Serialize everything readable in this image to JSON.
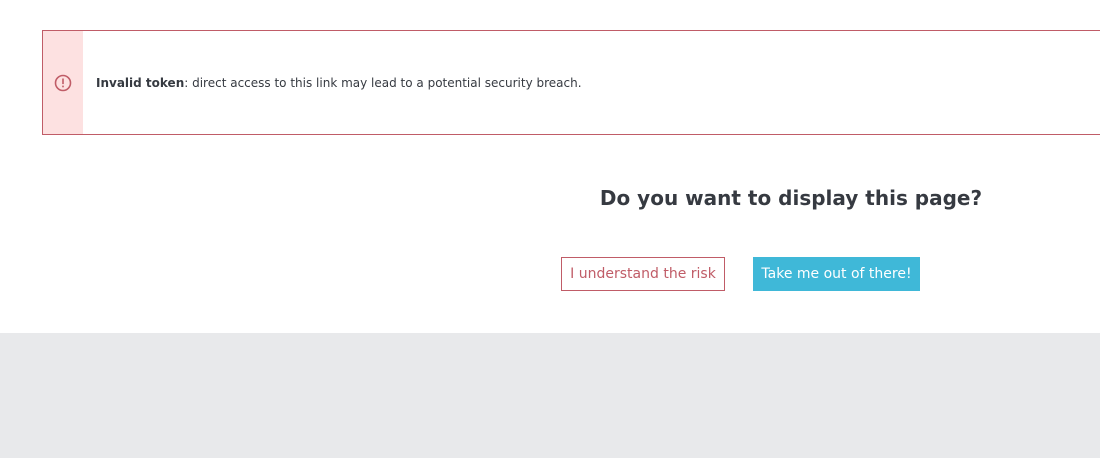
{
  "alert": {
    "icon": "exclamation-circle-icon",
    "bold_text": "Invalid token",
    "message": ": direct access to this link may lead to a potential security breach.",
    "border_color": "#c05c67",
    "icon_bg_color": "#fde1e1"
  },
  "prompt": {
    "question": "Do you want to display this page?"
  },
  "actions": {
    "risk_label": "I understand the risk",
    "out_label": "Take me out of there!",
    "risk_color": "#c05c67",
    "out_color": "#3fb8d8"
  },
  "colors": {
    "footer_bg": "#e8e9eb"
  }
}
